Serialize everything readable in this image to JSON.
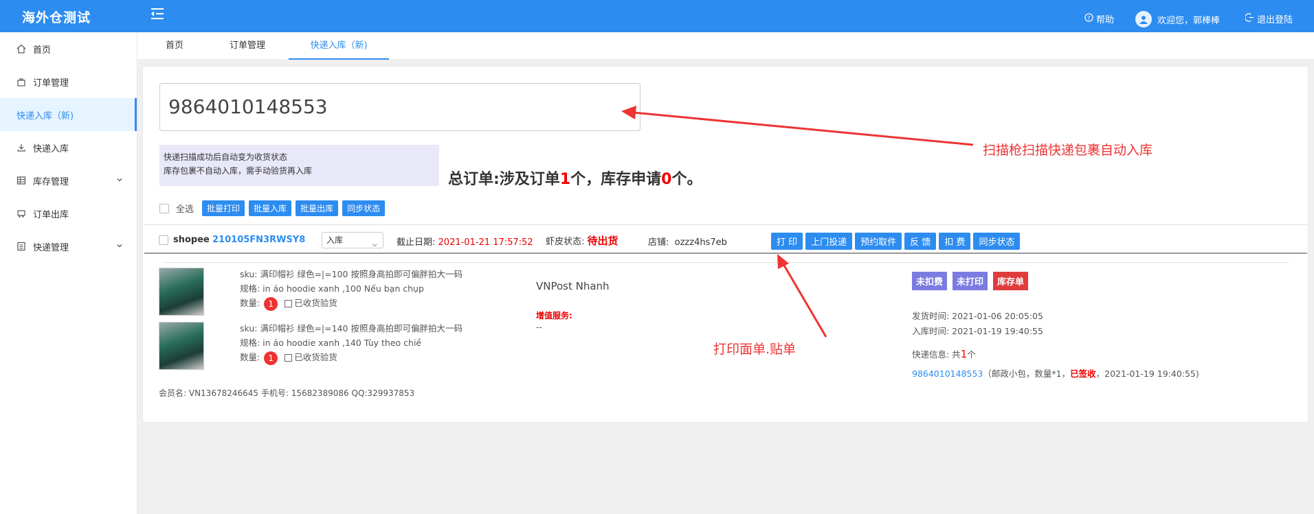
{
  "app": {
    "title": "海外仓测试"
  },
  "topbar": {
    "help": "帮助",
    "welcome": "欢迎您，郭棒棒",
    "logout": "退出登陆"
  },
  "sidebar": {
    "items": [
      {
        "label": "首页"
      },
      {
        "label": "订单管理"
      },
      {
        "label": "快递入库（新)"
      },
      {
        "label": "快递入库"
      },
      {
        "label": "库存管理"
      },
      {
        "label": "订单出库"
      },
      {
        "label": "快递管理"
      }
    ]
  },
  "tabs": [
    {
      "label": "首页"
    },
    {
      "label": "订单管理"
    },
    {
      "label": "快递入库（新)"
    }
  ],
  "scan": {
    "value": "9864010148553"
  },
  "tips": {
    "line1": "快递扫描成功后自动变为收货状态",
    "line2": "库存包裹不自动入库，需手动验货再入库"
  },
  "summary": {
    "prefix": "总订单:涉及订单",
    "orders": "1",
    "middle": "个，库存申请",
    "stock": "0",
    "suffix": "个。"
  },
  "bulk": {
    "select_all": "全选",
    "buttons": [
      "批量打印",
      "批量入库",
      "批量出库",
      "同步状态"
    ]
  },
  "order": {
    "platform": "shopee",
    "order_no": "210105FN3RWSY8",
    "status_select": "入库",
    "deadline_label": "截止日期:",
    "deadline": "2021-01-21 17:57:52",
    "shopee_status_label": "虾皮状态:",
    "shopee_status": "待出货",
    "store_label": "店铺:",
    "store": "ozzz4hs7eb",
    "actions": [
      "打 印",
      "上门投递",
      "预约取件",
      "反 馈",
      "扣 费",
      "同步状态"
    ],
    "items": [
      {
        "sku": "sku: 满印帽衫 绿色=|=100 按照身高拍即可偏胖拍大一码",
        "spec": "规格:   in áo hoodie xanh ,100 Nếu bạn chụp",
        "qty_label": "数量:",
        "qty": "1",
        "check_label": "已收货验货"
      },
      {
        "sku": "sku: 满印帽衫 绿色=|=140 按照身高拍即可偏胖拍大一码",
        "spec": "规格:   in áo hoodie xanh ,140 Tùy theo chiề",
        "qty_label": "数量:",
        "qty": "1",
        "check_label": "已收货验货"
      }
    ],
    "shipping": "VNPost Nhanh",
    "vas_label": "增值服务:",
    "vas_value": "--",
    "badges": [
      {
        "label": "未扣费",
        "color": "#7b7be0"
      },
      {
        "label": "未打印",
        "color": "#7b7be0"
      },
      {
        "label": "库存单",
        "color": "#e03c3c"
      }
    ],
    "ship_time": "发货时间:  2021-01-06 20:05:05",
    "inbound_time": "入库时间:  2021-01-19 19:40:55",
    "express_prefix": "快递信息:  共",
    "express_count": "1",
    "express_suffix": "个",
    "tracking_no": "9864010148553",
    "tracking_detail": "（邮政小包，数量*1，",
    "tracking_status": "已签收",
    "tracking_time": "，2021-01-19 19:40:55)",
    "member": "会员名:  VN13678246645     手机号:  15682389086     QQ:329937853"
  },
  "annotations": {
    "scan": "扫描枪扫描快递包裹自动入库",
    "print": "打印面单.贴单"
  },
  "colors": {
    "primary": "#2d8cf0",
    "danger": "#e33"
  }
}
